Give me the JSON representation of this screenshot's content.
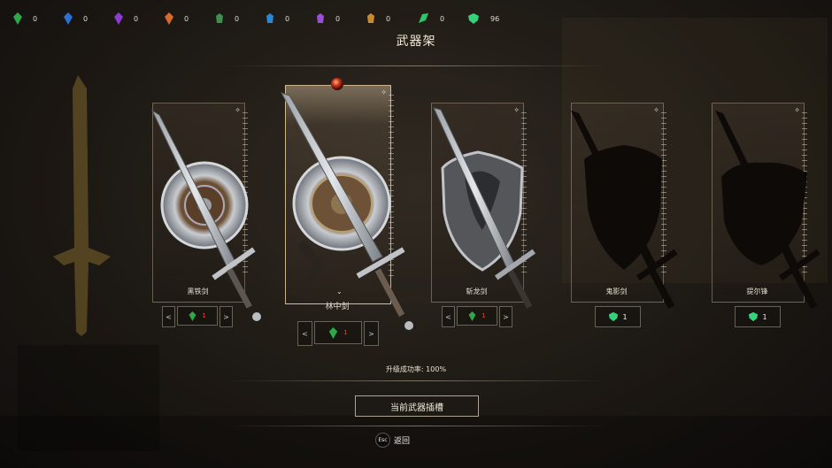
{
  "resources": [
    {
      "icon": "green-crystal-icon",
      "count": "0",
      "color": "#2fa84a"
    },
    {
      "icon": "blue-crystal-icon",
      "count": "0",
      "color": "#2d6fd4"
    },
    {
      "icon": "purple-crystal-icon",
      "count": "0",
      "color": "#8e3bd1"
    },
    {
      "icon": "orange-crystal-icon",
      "count": "0",
      "color": "#d46b2d"
    },
    {
      "icon": "green-stone-icon",
      "count": "0",
      "color": "#3f8f4f"
    },
    {
      "icon": "blue-stone-icon",
      "count": "0",
      "color": "#2d86d4"
    },
    {
      "icon": "violet-stone-icon",
      "count": "0",
      "color": "#9b4fd8"
    },
    {
      "icon": "amber-stone-icon",
      "count": "0",
      "color": "#c9892e"
    },
    {
      "icon": "green-leaf-gem-icon",
      "count": "0",
      "color": "#2fc36a"
    },
    {
      "icon": "green-ore-icon",
      "count": "96",
      "color": "#37d17a"
    }
  ],
  "title": "武器架",
  "weapons": [
    {
      "name": "黑铁剑",
      "cost": "1",
      "type": "stepper"
    },
    {
      "name": "林中剑",
      "cost": "1",
      "type": "stepper",
      "selected": true
    },
    {
      "name": "斩龙剑",
      "cost": "1",
      "type": "stepper"
    },
    {
      "name": "鬼影剑",
      "cost": "1",
      "type": "locked"
    },
    {
      "name": "提尔锋",
      "cost": "1",
      "type": "locked"
    }
  ],
  "stepper": {
    "prev": "<",
    "next": ">"
  },
  "success_rate": "升级成功率: 100%",
  "slot_button": "当前武器插槽",
  "back": {
    "key": "Esc",
    "label": "返回"
  }
}
